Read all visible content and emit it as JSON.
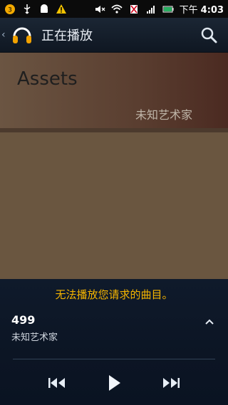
{
  "status_bar": {
    "notification_count": "3",
    "time_prefix": "下午",
    "time": "4:03"
  },
  "action_bar": {
    "title": "正在播放"
  },
  "album": {
    "title": "Assets",
    "artist": "未知艺术家"
  },
  "player": {
    "error_message": "无法播放您请求的曲目。",
    "track_title": "499",
    "track_artist": "未知艺术家"
  },
  "colors": {
    "accent": "#f4b400",
    "actionbar": "#1b2634",
    "art_bottom": "#6a5640"
  }
}
